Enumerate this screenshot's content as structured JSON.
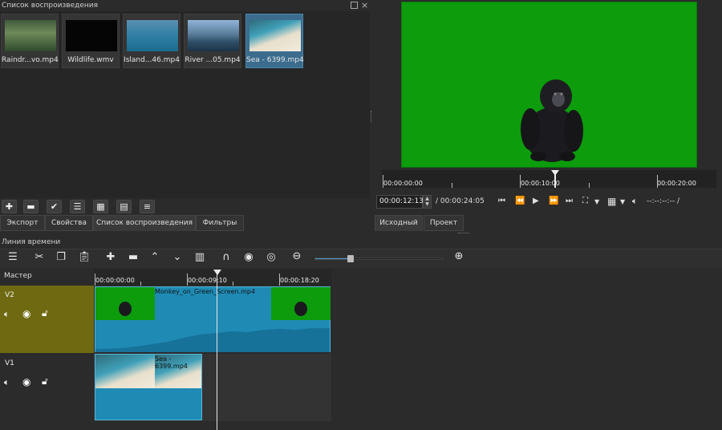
{
  "playlist": {
    "title": "Список воспроизведения",
    "items": [
      {
        "label": "Raindr...vo.mp4",
        "selected": false
      },
      {
        "label": "Wildlife.wmv",
        "selected": false
      },
      {
        "label": "Island...46.mp4",
        "selected": false
      },
      {
        "label": "River ...05.mp4",
        "selected": false
      },
      {
        "label": "Sea - 6399.mp4",
        "selected": true
      }
    ],
    "toolbar_icons": [
      "plus-icon",
      "minus-icon",
      "check-icon",
      "list-details-icon",
      "grid-icon",
      "table-icon",
      "menu-icon"
    ],
    "tabs": [
      "Экспорт",
      "Свойства",
      "Список воспроизведения",
      "Фильтры"
    ],
    "active_tab": "Список воспроизведения"
  },
  "player": {
    "ruler_labels": [
      "00:00:00:00",
      "00:00:10:00",
      "00:00:20:00"
    ],
    "current_time": "00:00:12:13",
    "total_time": "/ 00:00:24:05",
    "in_out": "--:--:--:-- /",
    "tabs": [
      "Исходный",
      "Проект"
    ],
    "preview_bg": "#0c9c0c"
  },
  "timeline": {
    "title": "Линия времени",
    "master_label": "Мастер",
    "ruler_labels": [
      "00:00:00:00",
      "00:00:09:10",
      "00:00:18:20"
    ],
    "zoom_fraction": 0.28,
    "tracks": [
      {
        "name": "V2",
        "clip": "Monkey_on_Green_Screen.mp4"
      },
      {
        "name": "V1",
        "clip": "Sea - 6399.mp4"
      }
    ]
  }
}
